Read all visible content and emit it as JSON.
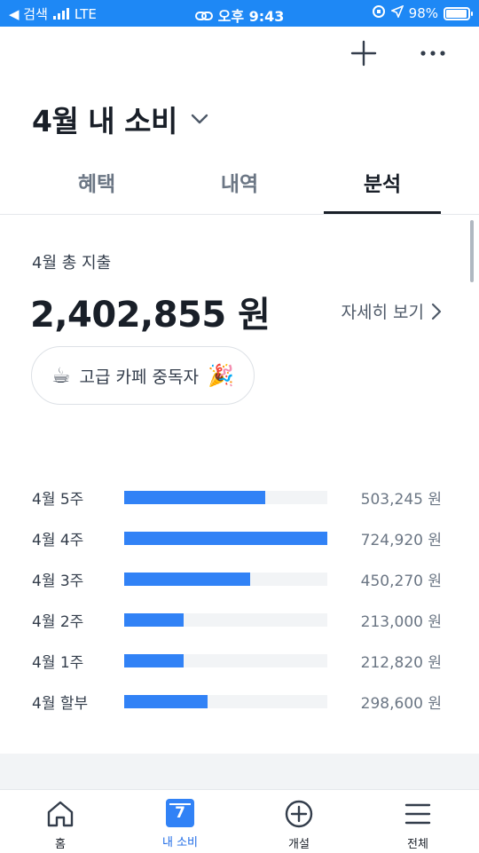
{
  "status_bar": {
    "back_label": "◀ 검색",
    "network": "LTE",
    "time": "오후 9:43",
    "battery": "98%",
    "bg_color": "#1e88f5"
  },
  "header": {
    "add_icon": "plus-icon",
    "more_icon": "more-icon",
    "title": "4월 내 소비",
    "title_dropdown_icon": "chevron-down-icon"
  },
  "tabs": [
    {
      "label": "혜택",
      "active": false
    },
    {
      "label": "내역",
      "active": false
    },
    {
      "label": "분석",
      "active": true
    }
  ],
  "summary": {
    "label": "4월 총 지출",
    "amount": "2,402,855 원",
    "detail_link": "자세히 보기",
    "badge_emoji_left": "☕",
    "badge_text": "고급 카페 중독자",
    "badge_emoji_right": "🎉"
  },
  "weekly": {
    "bar_color": "#3182f6",
    "track_color": "#f2f4f6",
    "max_value": 724920,
    "rows": [
      {
        "label": "4월 5주",
        "value_text": "503,245 원",
        "value": 503245
      },
      {
        "label": "4월 4주",
        "value_text": "724,920 원",
        "value": 724920
      },
      {
        "label": "4월 3주",
        "value_text": "450,270 원",
        "value": 450270
      },
      {
        "label": "4월 2주",
        "value_text": "213,000 원",
        "value": 213000
      },
      {
        "label": "4월 1주",
        "value_text": "212,820 원",
        "value": 212820
      },
      {
        "label": "4월 할부",
        "value_text": "298,600 원",
        "value": 298600
      }
    ]
  },
  "bottom_nav": [
    {
      "label": "홈",
      "icon": "home-icon",
      "active": false
    },
    {
      "label": "내 소비",
      "icon": "calendar-icon",
      "icon_text": "7",
      "active": true
    },
    {
      "label": "개설",
      "icon": "plus-circle-icon",
      "active": false
    },
    {
      "label": "전체",
      "icon": "menu-icon",
      "active": false
    }
  ]
}
